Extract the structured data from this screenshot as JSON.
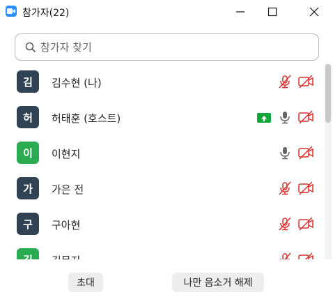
{
  "window": {
    "title": "참가자(22)"
  },
  "search": {
    "placeholder": "참가자 찾기"
  },
  "participants": [
    {
      "initial": "김",
      "name": "김수현 (나)",
      "color": "#2f4354",
      "mic": "muted",
      "video": "off",
      "sharing": false
    },
    {
      "initial": "허",
      "name": "허태훈 (호스트)",
      "color": "#2f4354",
      "mic": "on",
      "video": "off",
      "sharing": true
    },
    {
      "initial": "이",
      "name": "이현지",
      "color": "#2aab4f",
      "mic": "on",
      "video": "off",
      "sharing": false
    },
    {
      "initial": "가",
      "name": "가은 전",
      "color": "#2f4354",
      "mic": "muted",
      "video": "off",
      "sharing": false
    },
    {
      "initial": "구",
      "name": "구아현",
      "color": "#2f4354",
      "mic": "muted",
      "video": "off",
      "sharing": false
    },
    {
      "initial": "김",
      "name": "김문지",
      "color": "#2aab4f",
      "mic": "muted",
      "video": "off",
      "sharing": false
    }
  ],
  "footer": {
    "invite_label": "초대",
    "unmute_label": "나만 음소거 해제"
  },
  "colors": {
    "accent": "#2D8CFF",
    "muted_red": "#d9302e",
    "share_green": "#14a53c"
  },
  "icons": {
    "mic_muted": "mic-muted-icon",
    "mic_on": "mic-icon",
    "video_off": "video-off-icon",
    "share": "share-screen-icon"
  }
}
